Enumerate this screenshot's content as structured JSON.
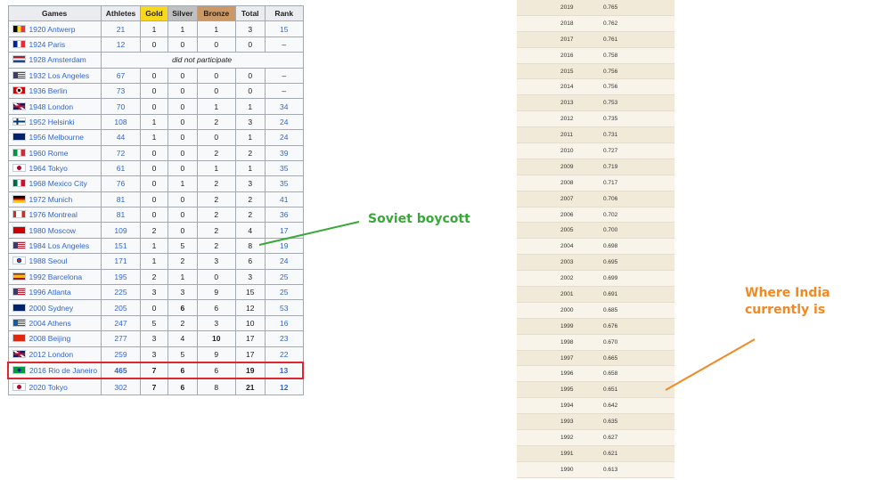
{
  "medal_table": {
    "headers": {
      "games": "Games",
      "athletes": "Athletes",
      "gold": "Gold",
      "silver": "Silver",
      "bronze": "Bronze",
      "total": "Total",
      "rank": "Rank"
    },
    "rows": [
      {
        "games": "1920 Antwerp",
        "flag": "belgium",
        "athletes": "21",
        "gold": "1",
        "silver": "1",
        "bronze": "1",
        "total": "3",
        "rank": "15"
      },
      {
        "games": "1924 Paris",
        "flag": "france",
        "athletes": "12",
        "gold": "0",
        "silver": "0",
        "bronze": "0",
        "total": "0",
        "rank": "–"
      },
      {
        "games": "1928 Amsterdam",
        "flag": "netherlands",
        "note": "did not participate"
      },
      {
        "games": "1932 Los Angeles",
        "flag": "usa",
        "athletes": "67",
        "gold": "0",
        "silver": "0",
        "bronze": "0",
        "total": "0",
        "rank": "–"
      },
      {
        "games": "1936 Berlin",
        "flag": "germany-1936",
        "athletes": "73",
        "gold": "0",
        "silver": "0",
        "bronze": "0",
        "total": "0",
        "rank": "–"
      },
      {
        "games": "1948 London",
        "flag": "uk",
        "athletes": "70",
        "gold": "0",
        "silver": "0",
        "bronze": "1",
        "total": "1",
        "rank": "34"
      },
      {
        "games": "1952 Helsinki",
        "flag": "finland",
        "athletes": "108",
        "gold": "1",
        "silver": "0",
        "bronze": "2",
        "total": "3",
        "rank": "24"
      },
      {
        "games": "1956 Melbourne",
        "flag": "australia",
        "athletes": "44",
        "gold": "1",
        "silver": "0",
        "bronze": "0",
        "total": "1",
        "rank": "24"
      },
      {
        "games": "1960 Rome",
        "flag": "italy",
        "athletes": "72",
        "gold": "0",
        "silver": "0",
        "bronze": "2",
        "total": "2",
        "rank": "39"
      },
      {
        "games": "1964 Tokyo",
        "flag": "japan",
        "athletes": "61",
        "gold": "0",
        "silver": "0",
        "bronze": "1",
        "total": "1",
        "rank": "35"
      },
      {
        "games": "1968 Mexico City",
        "flag": "mexico",
        "athletes": "76",
        "gold": "0",
        "silver": "1",
        "bronze": "2",
        "total": "3",
        "rank": "35"
      },
      {
        "games": "1972 Munich",
        "flag": "west-germany",
        "athletes": "81",
        "gold": "0",
        "silver": "0",
        "bronze": "2",
        "total": "2",
        "rank": "41"
      },
      {
        "games": "1976 Montreal",
        "flag": "canada",
        "athletes": "81",
        "gold": "0",
        "silver": "0",
        "bronze": "2",
        "total": "2",
        "rank": "36"
      },
      {
        "games": "1980 Moscow",
        "flag": "ussr",
        "athletes": "109",
        "gold": "2",
        "silver": "0",
        "bronze": "2",
        "total": "4",
        "rank": "17"
      },
      {
        "games": "1984 Los Angeles",
        "flag": "usa",
        "athletes": "151",
        "gold": "1",
        "silver": "5",
        "bronze": "2",
        "total": "8",
        "rank": "19"
      },
      {
        "games": "1988 Seoul",
        "flag": "south-korea",
        "athletes": "171",
        "gold": "1",
        "silver": "2",
        "bronze": "3",
        "total": "6",
        "rank": "24"
      },
      {
        "games": "1992 Barcelona",
        "flag": "spain",
        "athletes": "195",
        "gold": "2",
        "silver": "1",
        "bronze": "0",
        "total": "3",
        "rank": "25"
      },
      {
        "games": "1996 Atlanta",
        "flag": "usa",
        "athletes": "225",
        "gold": "3",
        "silver": "3",
        "bronze": "9",
        "total": "15",
        "rank": "25"
      },
      {
        "games": "2000 Sydney",
        "flag": "australia",
        "athletes": "205",
        "gold": "0",
        "silver": "6",
        "bronze": "6",
        "total": "12",
        "rank": "53"
      },
      {
        "games": "2004 Athens",
        "flag": "greece",
        "athletes": "247",
        "gold": "5",
        "silver": "2",
        "bronze": "3",
        "total": "10",
        "rank": "16"
      },
      {
        "games": "2008 Beijing",
        "flag": "china",
        "athletes": "277",
        "gold": "3",
        "silver": "4",
        "bronze": "10",
        "total": "17",
        "rank": "23"
      },
      {
        "games": "2012 London",
        "flag": "uk",
        "athletes": "259",
        "gold": "3",
        "silver": "5",
        "bronze": "9",
        "total": "17",
        "rank": "22"
      },
      {
        "games": "2016 Rio de Janeiro",
        "flag": "brazil",
        "athletes": "465",
        "gold": "7",
        "silver": "6",
        "bronze": "6",
        "total": "19",
        "rank": "13",
        "highlight": true
      },
      {
        "games": "2020 Tokyo",
        "flag": "japan",
        "athletes": "302",
        "gold": "7",
        "silver": "6",
        "bronze": "8",
        "total": "21",
        "rank": "12"
      }
    ]
  },
  "hdi_table": {
    "rows": [
      {
        "year": "2019",
        "value": "0.765"
      },
      {
        "year": "2018",
        "value": "0.762"
      },
      {
        "year": "2017",
        "value": "0.761"
      },
      {
        "year": "2016",
        "value": "0.758"
      },
      {
        "year": "2015",
        "value": "0.756"
      },
      {
        "year": "2014",
        "value": "0.756"
      },
      {
        "year": "2013",
        "value": "0.753"
      },
      {
        "year": "2012",
        "value": "0.735"
      },
      {
        "year": "2011",
        "value": "0.731"
      },
      {
        "year": "2010",
        "value": "0.727"
      },
      {
        "year": "2009",
        "value": "0.719"
      },
      {
        "year": "2008",
        "value": "0.717"
      },
      {
        "year": "2007",
        "value": "0.706"
      },
      {
        "year": "2006",
        "value": "0.702"
      },
      {
        "year": "2005",
        "value": "0.700"
      },
      {
        "year": "2004",
        "value": "0.698"
      },
      {
        "year": "2003",
        "value": "0.695"
      },
      {
        "year": "2002",
        "value": "0.699"
      },
      {
        "year": "2001",
        "value": "0.691"
      },
      {
        "year": "2000",
        "value": "0.685"
      },
      {
        "year": "1999",
        "value": "0.676"
      },
      {
        "year": "1998",
        "value": "0.670"
      },
      {
        "year": "1997",
        "value": "0.665"
      },
      {
        "year": "1996",
        "value": "0.658"
      },
      {
        "year": "1995",
        "value": "0.651"
      },
      {
        "year": "1994",
        "value": "0.642"
      },
      {
        "year": "1993",
        "value": "0.635"
      },
      {
        "year": "1992",
        "value": "0.627"
      },
      {
        "year": "1991",
        "value": "0.621"
      },
      {
        "year": "1990",
        "value": "0.613"
      }
    ]
  },
  "annotations": {
    "soviet": "Soviet boycott",
    "india_line1": "Where India",
    "india_line2": "currently is",
    "soviet_color": "#38a839",
    "india_color": "#f08a24",
    "highlight_color": "#e0262d"
  }
}
